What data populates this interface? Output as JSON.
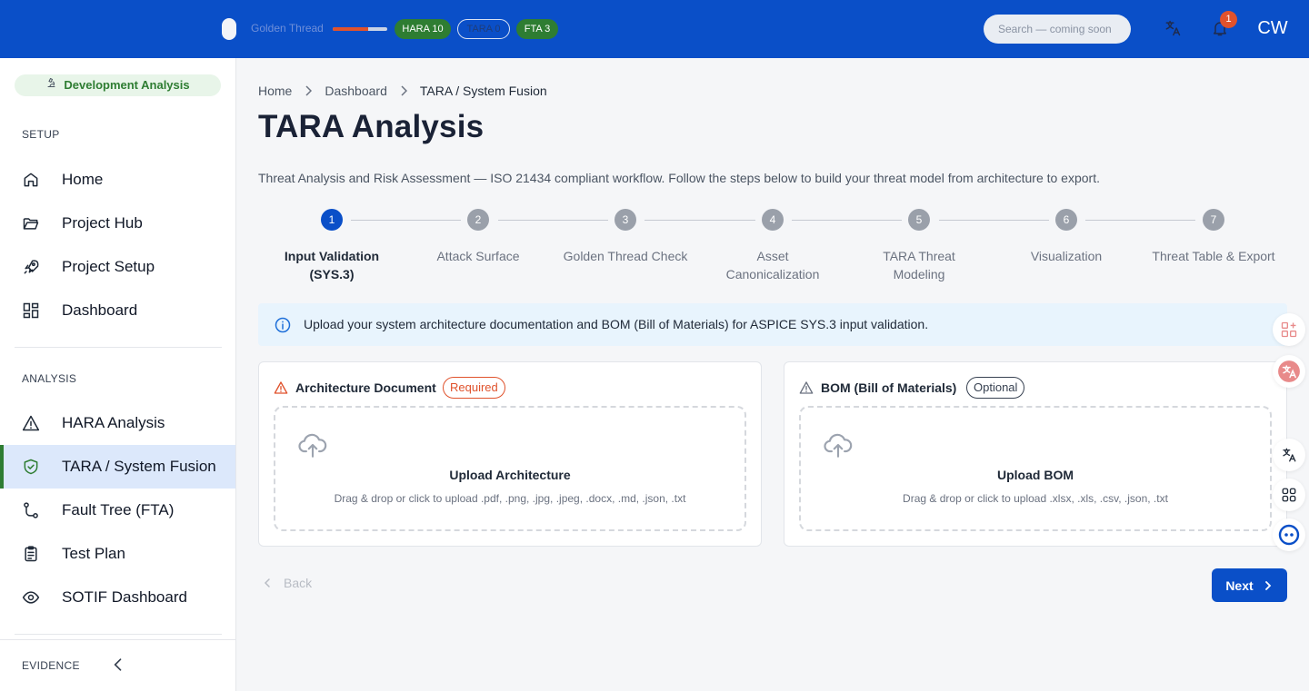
{
  "topbar": {
    "golden_thread_label": "Golden Thread",
    "golden_thread_progress": 0.65,
    "badges": {
      "hara": "HARA 10",
      "tara": "TARA 0",
      "fta": "FTA 3"
    },
    "search_placeholder": "Search — coming soon",
    "notification_count": "1",
    "avatar_initials": "CW"
  },
  "sidebar": {
    "mode_chip": "Development Analysis",
    "sections": {
      "setup": "SETUP",
      "analysis": "ANALYSIS",
      "evidence": "EVIDENCE"
    },
    "setup_items": [
      {
        "label": "Home",
        "icon": "home-icon"
      },
      {
        "label": "Project Hub",
        "icon": "folder-open-icon"
      },
      {
        "label": "Project Setup",
        "icon": "rocket-icon"
      },
      {
        "label": "Dashboard",
        "icon": "dashboard-icon"
      }
    ],
    "analysis_items": [
      {
        "label": "HARA Analysis",
        "icon": "warning-icon"
      },
      {
        "label": "TARA / System Fusion",
        "icon": "shield-check-icon",
        "active": true
      },
      {
        "label": "Fault Tree (FTA)",
        "icon": "fault-tree-icon"
      },
      {
        "label": "Test Plan",
        "icon": "clipboard-icon"
      },
      {
        "label": "SOTIF Dashboard",
        "icon": "eye-icon"
      }
    ]
  },
  "main": {
    "breadcrumb": [
      "Home",
      "Dashboard",
      "TARA / System Fusion"
    ],
    "title": "TARA Analysis",
    "description": "Threat Analysis and Risk Assessment — ISO 21434 compliant workflow. Follow the steps below to build your threat model from architecture to export.",
    "steps": [
      {
        "num": "1",
        "label": "Input Validation (SYS.3)",
        "active": true
      },
      {
        "num": "2",
        "label": "Attack Surface"
      },
      {
        "num": "3",
        "label": "Golden Thread Check"
      },
      {
        "num": "4",
        "label": "Asset Canonicalization"
      },
      {
        "num": "5",
        "label": "TARA Threat Modeling"
      },
      {
        "num": "6",
        "label": "Visualization"
      },
      {
        "num": "7",
        "label": "Threat Table & Export"
      }
    ],
    "info_text": "Upload your system architecture documentation and BOM (Bill of Materials) for ASPICE SYS.3 input validation.",
    "cards": {
      "architecture": {
        "title": "Architecture Document",
        "chip": "Required",
        "upload_title": "Upload Architecture",
        "upload_hint": "Drag & drop or click to upload .pdf, .png, .jpg, .jpeg, .docx, .md, .json, .txt"
      },
      "bom": {
        "title": "BOM (Bill of Materials)",
        "chip": "Optional",
        "upload_title": "Upload BOM",
        "upload_hint": "Drag & drop or click to upload .xlsx, .xls, .csv, .json, .txt"
      }
    },
    "back_label": "Back",
    "next_label": "Next"
  },
  "colors": {
    "primary": "#0a4fc8",
    "success": "#2e7d32",
    "accent_orange": "#e0522c",
    "info_bg": "#e8f4fd"
  }
}
